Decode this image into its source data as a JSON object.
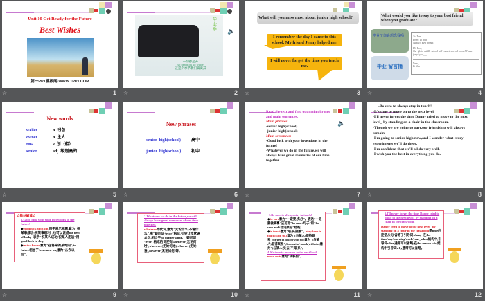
{
  "slides": [
    {
      "number": "1",
      "subtitle": "Unit 10  Get Ready for the Future",
      "title": "Best Wishes",
      "footer": "第一PPT模板网-WWW.1PPT.COM"
    },
    {
      "number": "2",
      "caption_cn": "一切都是开",
      "caption_en": "so beautiful so white",
      "caption_cn2": "这是个季节我们将离开",
      "side_text": "毕业季"
    },
    {
      "number": "3",
      "question": "What will you miss most about junior high school?",
      "bubble1_underlined": "I remember the day",
      "bubble1_rest": " I came to this school. My friend Jenny helped me.",
      "bubble2": "I will never forget the time you teach me."
    },
    {
      "number": "4",
      "question": "What would you like to say to your best friend when you graduate?",
      "photo1_text": "毕业了你会想念我吗",
      "photo2_text": "毕业·留言播",
      "email": {
        "to_label": "To:",
        "to": "Tom",
        "from_label": "From:",
        "from": "Li Hua",
        "subject_label": "Subject:",
        "subject": "Best wishes",
        "greeting": "Hi! Tom,",
        "body": "Our life in middle school will come to an end soon. I'll never forget you___",
        "closing": "Yours,",
        "sign": "Li Hua"
      }
    },
    {
      "number": "5",
      "title": "New words",
      "words": [
        {
          "word": "wallet",
          "def": "n. 钱包"
        },
        {
          "word": "owner",
          "def": "n. 主人"
        },
        {
          "word": "row",
          "def": "v. 划（船）"
        },
        {
          "word": "senior",
          "def": "adj. 级别高的"
        }
      ]
    },
    {
      "number": "6",
      "title": "New phrases",
      "phrases": [
        {
          "en": "senior  high(school)",
          "cn": "高中"
        },
        {
          "en": "junior  high(school)",
          "cn": "初中"
        }
      ]
    },
    {
      "number": "7",
      "intro": "Read the text and find out main phrases and main sentences.",
      "phrases_label": "Main phrases:",
      "phrases": [
        "-senior high(school)",
        "-junior high(school)"
      ],
      "sentences_label": "Main sentences:",
      "sentences": [
        "-Good luck with your inventions in the future!",
        "-Whatever we do  in the future,we will always have great memories of our time together."
      ]
    },
    {
      "number": "8",
      "lines": [
        "-Be sure to always stay in touch!",
        "-It's time to move on to the next level.",
        "-I'll never forget the time Danny tried to move to the next level_ by standing on a chair in the classroom.",
        "-Though we are going to part,our friendship will always remain.",
        "-I'm going to senior high now,and I wonder what crazy experiments we'll do there.",
        "-I'm confident that we'll all do very well.",
        "-I wish you the best in everything you do."
      ]
    },
    {
      "number": "9",
      "heading": "☆教材解读☆",
      "point": "1.Good luck with your inventions in the future!",
      "b1_key": "good luck with sth.",
      "b1_text": "用于表示祝愿,意为\"祝某事成功;祝某事顺利\",也可以说成the best of luck。表示\"祝某人成功;祝某人走运\"用good luck to sb.。",
      "b2_key": "in the future",
      "b2_text": "意为\"在将来的某时间\";in future相当于from now on,意为\"从今以后\"。"
    },
    {
      "number": "10",
      "point": "2.Whatever we do in the future,we will always have great memories of our time together.",
      "key": "whatever",
      "text": "为代词,意为\"无论什么;不管什么\",由\"疑问词+ever\"构成,引导让步状语从句,相当于no matter what。\"疑问词+ever\"构成的词还有whenever(无论何时),wherever(无论何地),whoever(无论谁),however(无论如何)等。"
    },
    {
      "number": "11",
      "point": "3.Be sure to always stay in touch!",
      "k1": "be sure",
      "t1": "意为\"一定要;务必\"。表达\"一定要做某事\"还可用\"be sure+句子\"和\"be sure and+动词原形\"结构。",
      "k2": "in touch",
      "t2": "意为\"联系;接触\"。",
      "k3": "stay/keep in touch(with sb.)",
      "t3": "意为\"(与某人)保持联系\";be/get in touch(with sb.)意为\"(与某人)取得联系\";lose/out of touch(with sb.)意为\"(与某人)失去(不)联系\"。",
      "point2": "4.It's time to move on to the next level.",
      "k4": "move on to",
      "t4": "意为\"转移到\"。"
    },
    {
      "number": "12",
      "point": "5.I'll never forget the time Danny tried to move to the next level_ by standing on a chair in the classroom.",
      "red": "Danny tried to move to the next level_ by standing on a chair in the classroom",
      "text": "是time的定语从句,省略了引导词when。在the time/day/morning/week/year_when结构中,引导词when通常可以省略;在the reason why结构中引导词why通常可以省略。"
    }
  ],
  "colors": {
    "background": "#555658",
    "title_red": "#e0131b",
    "word_blue": "#2b2fd0",
    "bubble": "#f6b40d",
    "accent_purple": "#c77ad0"
  },
  "icons": {
    "animation": "star-icon",
    "sound": "speaker-icon"
  }
}
